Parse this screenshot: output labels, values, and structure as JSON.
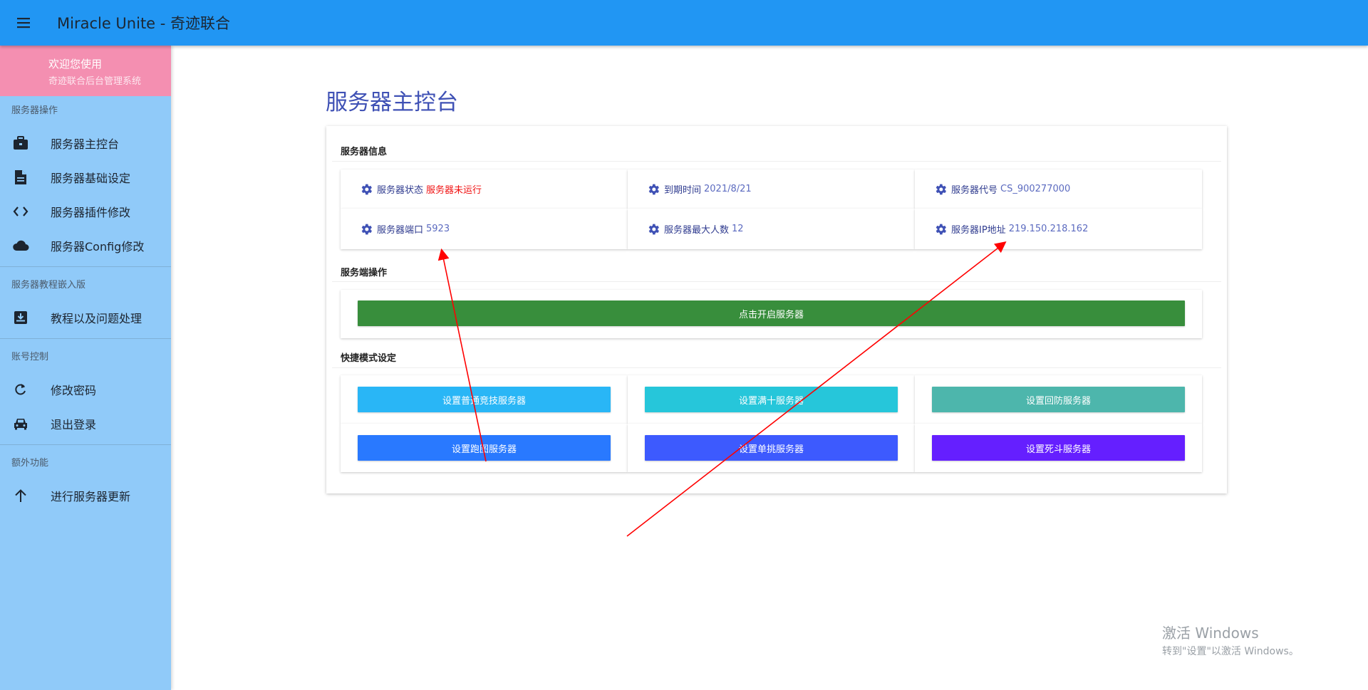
{
  "appbar": {
    "title": "Miracle Unite - 奇迹联合",
    "menu_icon": "menu-icon"
  },
  "sidebar": {
    "welcome_title": "欢迎您使用",
    "welcome_subtitle": "奇迹联合后台管理系统",
    "sections": [
      {
        "header": "服务器操作",
        "items": [
          {
            "label": "服务器主控台",
            "icon": "briefcase-icon"
          },
          {
            "label": "服务器基础设定",
            "icon": "document-icon"
          },
          {
            "label": "服务器插件修改",
            "icon": "code-icon"
          },
          {
            "label": "服务器Config修改",
            "icon": "cloud-icon"
          }
        ]
      },
      {
        "header": "服务器教程嵌入版",
        "items": [
          {
            "label": "教程以及问题处理",
            "icon": "download-box-icon"
          }
        ]
      },
      {
        "header": "账号控制",
        "items": [
          {
            "label": "修改密码",
            "icon": "refresh-icon"
          },
          {
            "label": "退出登录",
            "icon": "car-icon"
          }
        ]
      },
      {
        "header": "额外功能",
        "items": [
          {
            "label": "进行服务器更新",
            "icon": "arrow-up-icon"
          }
        ]
      }
    ]
  },
  "main": {
    "title": "服务器主控台",
    "info_section_title": "服务器信息",
    "info": [
      {
        "label": "服务器状态",
        "value": "服务器未运行"
      },
      {
        "label": "到期时间",
        "value": "2021/8/21"
      },
      {
        "label": "服务器代号",
        "value": "CS_900277000"
      },
      {
        "label": "服务器端口",
        "value": "5923"
      },
      {
        "label": "服务器最大人数",
        "value": "12"
      },
      {
        "label": "服务器IP地址",
        "value": "219.150.218.162"
      }
    ],
    "ops_section_title": "服务端操作",
    "start_button": "点击开启服务器",
    "mode_section_title": "快捷模式设定",
    "mode_buttons": [
      {
        "label": "设置普通竞技服务器"
      },
      {
        "label": "设置满十服务器"
      },
      {
        "label": "设置回防服务器"
      },
      {
        "label": "设置跑图服务器"
      },
      {
        "label": "设置单挑服务器"
      },
      {
        "label": "设置死斗服务器"
      }
    ]
  },
  "colors": {
    "appbar": "#2196f3",
    "sidebar": "#90caf9",
    "welcome": "#f48fb1",
    "title": "#3f51b5",
    "status_red": "#f01212",
    "start_green": "#388e3c",
    "mode_1": "#29b6f6",
    "mode_2": "#26c6da",
    "mode_3": "#4db6ac",
    "mode_4": "#2979ff",
    "mode_5": "#3d5afe",
    "mode_6": "#651fff",
    "annotation_arrow": "#ff0000"
  },
  "watermark": {
    "line1": "激活 Windows",
    "line2": "转到\"设置\"以激活 Windows。"
  }
}
